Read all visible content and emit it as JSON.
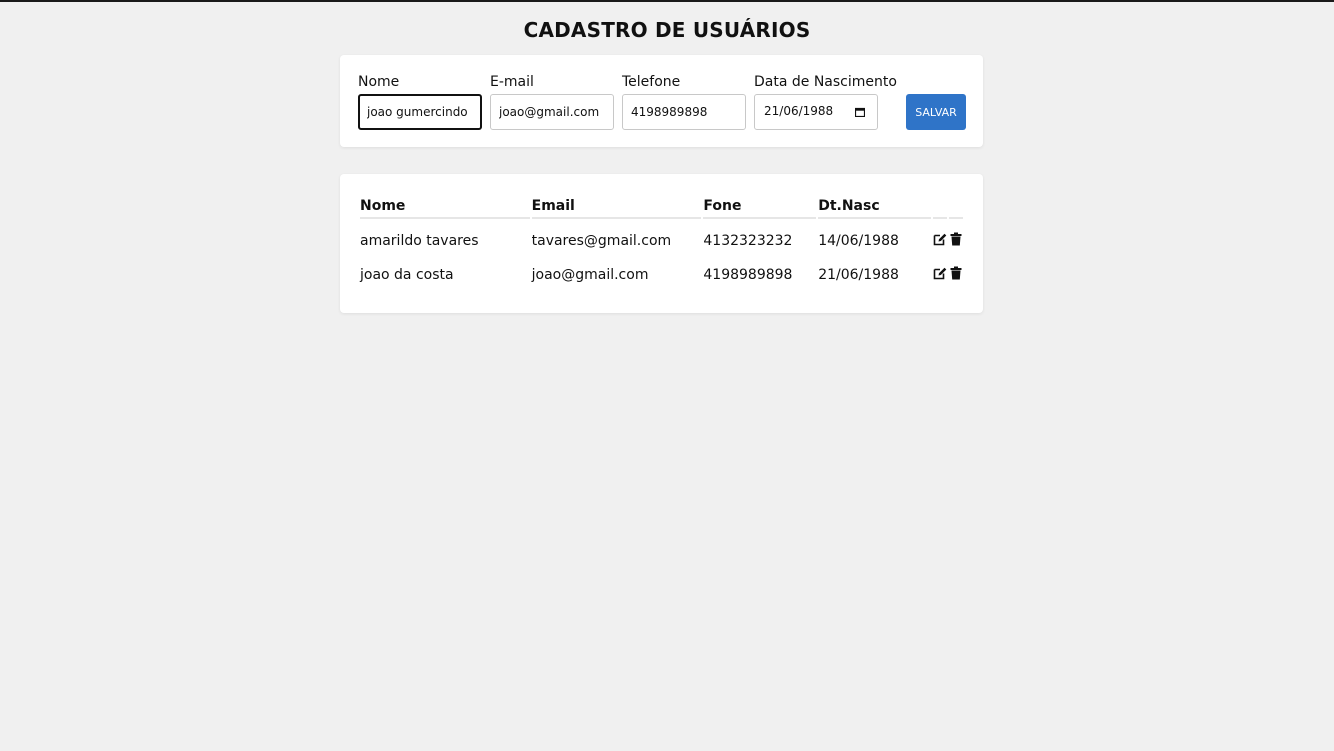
{
  "page": {
    "title": "CADASTRO DE USUÁRIOS"
  },
  "form": {
    "nome": {
      "label": "Nome",
      "value": "joao gumercindo"
    },
    "email": {
      "label": "E-mail",
      "value": "joao@gmail.com"
    },
    "telefone": {
      "label": "Telefone",
      "value": "4198989898"
    },
    "nascimento": {
      "label": "Data de Nascimento",
      "value": "21/06/1988"
    },
    "save_label": "SALVAR"
  },
  "table": {
    "headers": [
      "Nome",
      "Email",
      "Fone",
      "Dt.Nasc"
    ],
    "rows": [
      {
        "nome": "amarildo tavares",
        "email": "tavares@gmail.com",
        "fone": "4132323232",
        "nasc": "14/06/1988"
      },
      {
        "nome": "joao da costa",
        "email": "joao@gmail.com",
        "fone": "4198989898",
        "nasc": "21/06/1988"
      }
    ]
  },
  "icons": {
    "edit": "edit-icon",
    "delete": "trash-icon",
    "calendar": "calendar-icon"
  },
  "colors": {
    "accent": "#2f74c8",
    "background": "#f0f0f0",
    "card": "#ffffff"
  }
}
